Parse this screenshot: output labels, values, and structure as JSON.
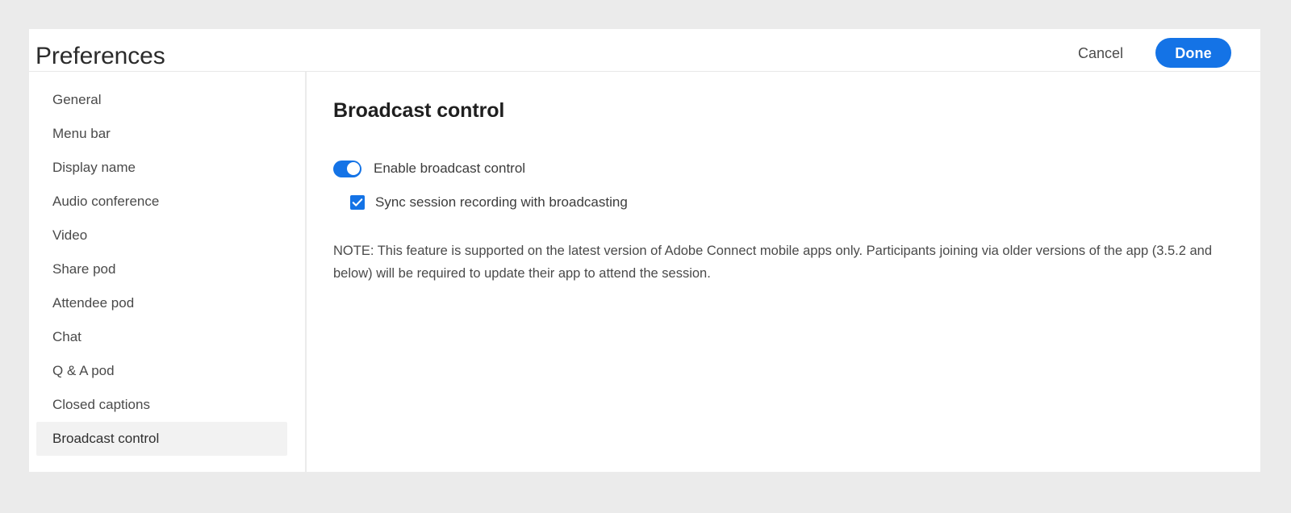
{
  "window": {
    "background_color": "#ebebeb",
    "dialog_background": "#ffffff"
  },
  "header": {
    "title": "Preferences",
    "cancel_label": "Cancel",
    "done_label": "Done",
    "accent_color": "#1473e6"
  },
  "sidebar": {
    "items": [
      {
        "label": "General",
        "selected": false
      },
      {
        "label": "Menu bar",
        "selected": false
      },
      {
        "label": "Display name",
        "selected": false
      },
      {
        "label": "Audio conference",
        "selected": false
      },
      {
        "label": "Video",
        "selected": false
      },
      {
        "label": "Share pod",
        "selected": false
      },
      {
        "label": "Attendee pod",
        "selected": false
      },
      {
        "label": "Chat",
        "selected": false
      },
      {
        "label": "Q & A pod",
        "selected": false
      },
      {
        "label": "Closed captions",
        "selected": false
      },
      {
        "label": "Broadcast control",
        "selected": true
      }
    ],
    "selected_background": "#f2f2f2"
  },
  "main": {
    "title": "Broadcast control",
    "toggle": {
      "label": "Enable broadcast control",
      "state": "on",
      "on_color": "#1473e6"
    },
    "checkbox": {
      "label": "Sync session recording with broadcasting",
      "state": "checked",
      "checked_color": "#1473e6"
    },
    "note": "NOTE: This feature is supported on the latest version of Adobe Connect mobile apps only. Participants joining via older versions of the app (3.5.2 and below) will be required to update their app to attend the session."
  }
}
